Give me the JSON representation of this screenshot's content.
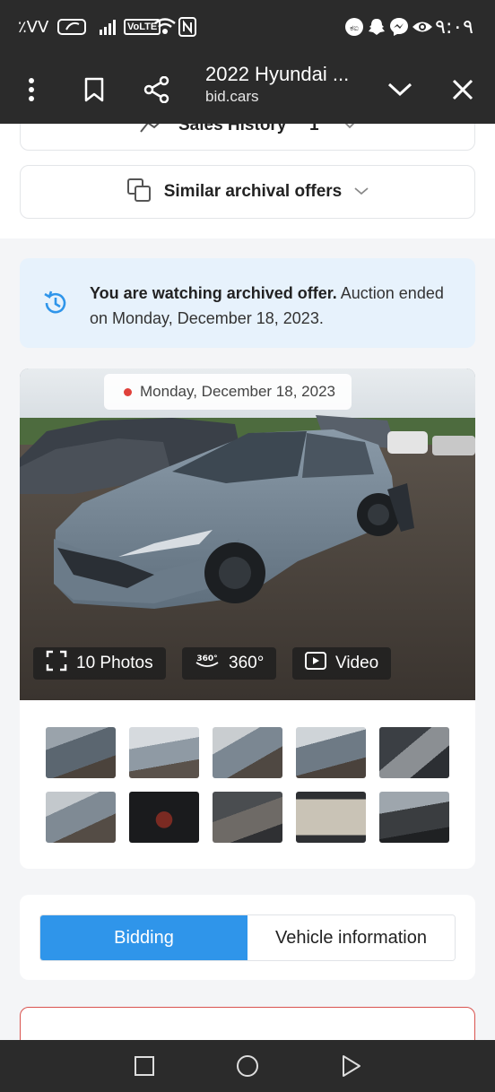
{
  "status_bar": {
    "left_text": "٪VV",
    "time": "٩:٠٩",
    "network_label": "VoLTE"
  },
  "browser": {
    "title": "2022 Hyundai ...",
    "url": "bid.cars"
  },
  "page": {
    "sales_history_label": "Sales History",
    "sales_history_count": "1",
    "similar_offers_label": "Similar archival offers",
    "archived_bold": "You are watching archived offer.",
    "archived_text": " Auction ended on Monday, December 18, 2023.",
    "photo_date": "Monday, December 18, 2023",
    "photos_label": "10 Photos",
    "view360_label": "360°",
    "video_label": "Video",
    "tabs": [
      {
        "label": "Bidding",
        "active": true
      },
      {
        "label": "Vehicle information",
        "active": false
      }
    ],
    "accent_color": "#2f95ea"
  }
}
